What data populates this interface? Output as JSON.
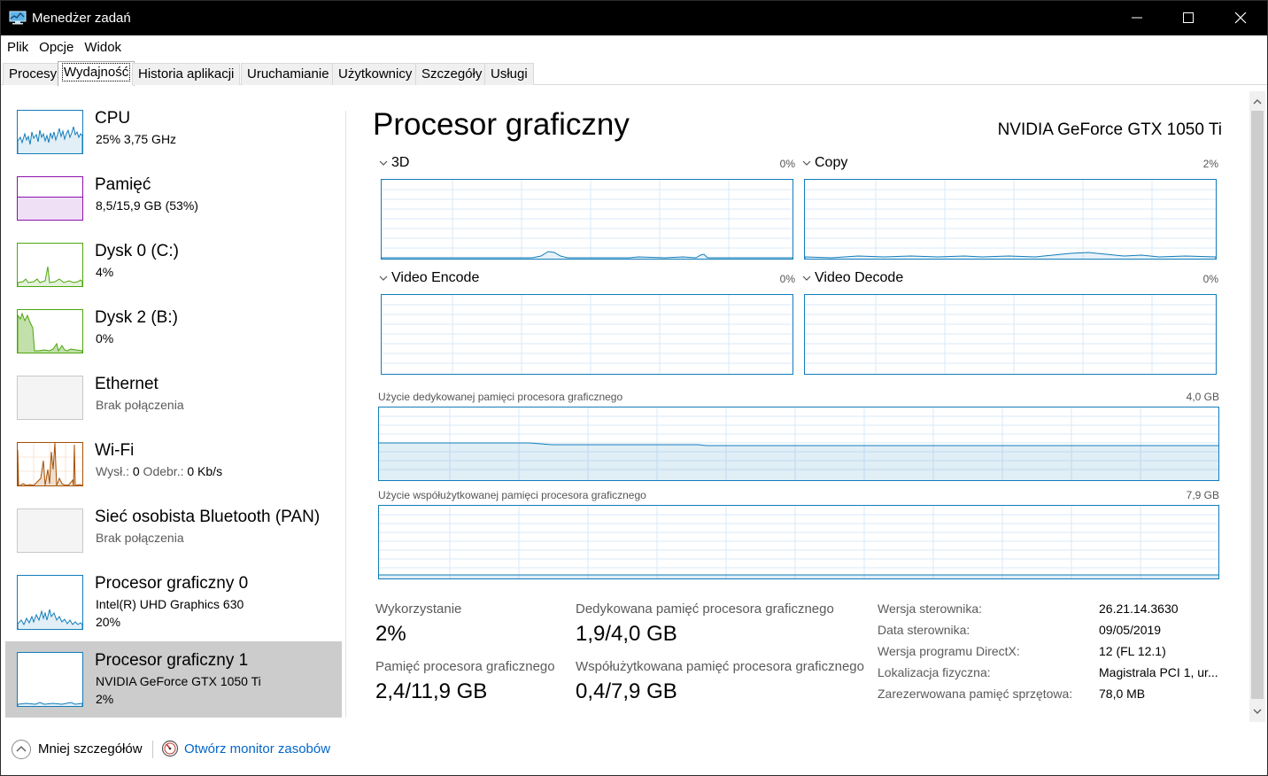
{
  "window": {
    "title": "Menedżer zadań",
    "icon": "task-manager-icon",
    "buttons": [
      "minimize-icon",
      "maximize-icon",
      "close-icon"
    ]
  },
  "menu": [
    "Plik",
    "Opcje",
    "Widok"
  ],
  "tabs": [
    {
      "label": "Procesy"
    },
    {
      "label": "Wydajność",
      "active": true
    },
    {
      "label": "Historia aplikacji"
    },
    {
      "label": "Uruchamianie"
    },
    {
      "label": "Użytkownicy"
    },
    {
      "label": "Szczegóły"
    },
    {
      "label": "Usługi"
    }
  ],
  "sidebar": [
    {
      "name": "CPU",
      "sub": "25% 3,75 GHz",
      "color": "#117dbb"
    },
    {
      "name": "Pamięć",
      "sub": "8,5/15,9 GB (53%)",
      "color": "#8b12ae",
      "level": 0.53
    },
    {
      "name": "Dysk 0 (C:)",
      "sub": "4%",
      "color": "#4da60c"
    },
    {
      "name": "Dysk 2 (B:)",
      "sub": "0%",
      "color": "#4da60c"
    },
    {
      "name": "Ethernet",
      "sub": "Brak połączenia",
      "color": "#c8c8c8"
    },
    {
      "name": "Wi-Fi",
      "sub_prefix1": "Wysł.: ",
      "sub_val1": "0",
      "sub_prefix2": " Odebr.: ",
      "sub_val2": "0 Kb/s",
      "color": "#a74f01"
    },
    {
      "name": "Sieć osobista Bluetooth (PAN)",
      "sub": "Brak połączenia",
      "color": "#c8c8c8"
    },
    {
      "name": "Procesor graficzny 0",
      "sub": "Intel(R) UHD Graphics 630",
      "sub2": "20%",
      "color": "#117dbb"
    },
    {
      "name": "Procesor graficzny 1",
      "sub": "NVIDIA GeForce GTX 1050 Ti",
      "sub2": "2%",
      "color": "#117dbb",
      "selected": true
    }
  ],
  "main": {
    "title": "Procesor graficzny",
    "model": "NVIDIA GeForce GTX 1050 Ti",
    "accent": "#117dbb",
    "engines": [
      {
        "label": "3D",
        "pct": "0%"
      },
      {
        "label": "Copy",
        "pct": "2%"
      },
      {
        "label": "Video Encode",
        "pct": "0%"
      },
      {
        "label": "Video Decode",
        "pct": "0%"
      }
    ],
    "dedicated": {
      "label": "Użycie dedykowanej pamięci procesora graficznego",
      "max": "4,0 GB"
    },
    "shared": {
      "label": "Użycie współużytkowanej pamięci procesora graficznego",
      "max": "7,9 GB"
    },
    "stats": {
      "utilization_label": "Wykorzystanie",
      "utilization": "2%",
      "dedicated_label": "Dedykowana pamięć procesora graficznego",
      "dedicated": "1,9/4,0 GB",
      "gpu_mem_label": "Pamięć procesora graficznego",
      "gpu_mem": "2,4/11,9 GB",
      "shared_label": "Współużytkowana pamięć procesora graficznego",
      "shared": "0,4/7,9 GB"
    },
    "info": [
      {
        "key": "Wersja sterownika:",
        "value": "26.21.14.3630"
      },
      {
        "key": "Data sterownika:",
        "value": "09/05/2019"
      },
      {
        "key": "Wersja programu DirectX:",
        "value": "12 (FL 12.1)"
      },
      {
        "key": "Lokalizacja fizyczna:",
        "value": "Magistrala PCI 1, ur..."
      },
      {
        "key": "Zarezerwowana pamięć sprzętowa:",
        "value": "78,0 MB"
      }
    ]
  },
  "footer": {
    "less_details": "Mniej szczegółów",
    "resource_monitor": "Otwórz monitor zasobów"
  }
}
